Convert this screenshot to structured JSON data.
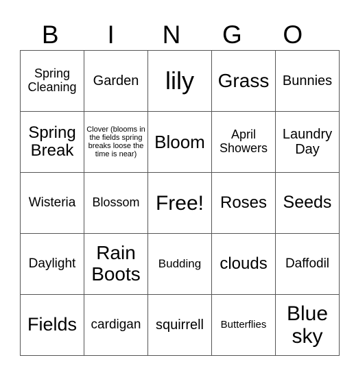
{
  "header": [
    "B",
    "I",
    "N",
    "G",
    "O"
  ],
  "cells": [
    [
      {
        "text": "Spring Cleaning",
        "size": 18
      },
      {
        "text": "Garden",
        "size": 20
      },
      {
        "text": "lily",
        "size": 36
      },
      {
        "text": "Grass",
        "size": 28
      },
      {
        "text": "Bunnies",
        "size": 20
      }
    ],
    [
      {
        "text": "Spring Break",
        "size": 24
      },
      {
        "text": "Clover (blooms in the fields spring breaks loose the time is near)",
        "size": 11
      },
      {
        "text": "Bloom",
        "size": 26
      },
      {
        "text": "April Showers",
        "size": 18
      },
      {
        "text": "Laundry Day",
        "size": 20
      }
    ],
    [
      {
        "text": "Wisteria",
        "size": 19
      },
      {
        "text": "Blossom",
        "size": 18
      },
      {
        "text": "Free!",
        "size": 30
      },
      {
        "text": "Roses",
        "size": 24
      },
      {
        "text": "Seeds",
        "size": 25
      }
    ],
    [
      {
        "text": "Daylight",
        "size": 19
      },
      {
        "text": "Rain Boots",
        "size": 28
      },
      {
        "text": "Budding",
        "size": 17
      },
      {
        "text": "clouds",
        "size": 24
      },
      {
        "text": "Daffodil",
        "size": 19
      }
    ],
    [
      {
        "text": "Fields",
        "size": 27
      },
      {
        "text": "cardigan",
        "size": 19
      },
      {
        "text": "squirrell",
        "size": 20
      },
      {
        "text": "Butterflies",
        "size": 15
      },
      {
        "text": "Blue sky",
        "size": 30
      }
    ]
  ]
}
